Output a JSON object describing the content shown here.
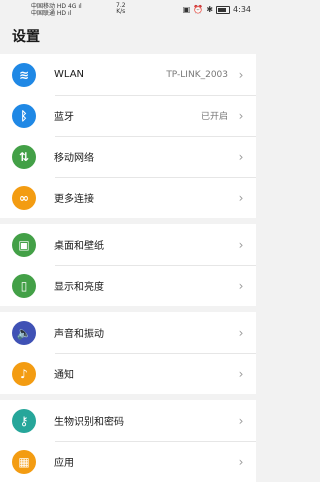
{
  "status_bar": {
    "carrier1": "中国移动 HD 4G ıl",
    "carrier2": "中国联通 HD ıl",
    "net_speed": "7.2\nK/s",
    "time": "4:34"
  },
  "page_title": "设置",
  "groups": [
    [
      {
        "name": "wlan",
        "label": "WLAN",
        "value": "TP-LINK_2003",
        "icon": "wifi-icon",
        "color": "#1f88e5"
      },
      {
        "name": "bluetooth",
        "label": "蓝牙",
        "value": "已开启",
        "icon": "bluetooth-icon",
        "color": "#1f88e5"
      },
      {
        "name": "mobile-network",
        "label": "移动网络",
        "value": "",
        "icon": "mobile-data-icon",
        "color": "#43a047"
      },
      {
        "name": "more-connections",
        "label": "更多连接",
        "value": "",
        "icon": "link-icon",
        "color": "#f39c12"
      }
    ],
    [
      {
        "name": "home-wallpaper",
        "label": "桌面和壁纸",
        "value": "",
        "icon": "image-icon",
        "color": "#43a047"
      },
      {
        "name": "display-brightness",
        "label": "显示和亮度",
        "value": "",
        "icon": "phone-display-icon",
        "color": "#43a047"
      }
    ],
    [
      {
        "name": "sound-vibration",
        "label": "声音和振动",
        "value": "",
        "icon": "speaker-icon",
        "color": "#3f51b5"
      },
      {
        "name": "notifications",
        "label": "通知",
        "value": "",
        "icon": "bell-icon",
        "color": "#f39c12"
      }
    ],
    [
      {
        "name": "biometrics-password",
        "label": "生物识别和密码",
        "value": "",
        "icon": "key-icon",
        "color": "#26a69a"
      },
      {
        "name": "apps",
        "label": "应用",
        "value": "",
        "icon": "apps-grid-icon",
        "color": "#f39c12"
      }
    ]
  ]
}
